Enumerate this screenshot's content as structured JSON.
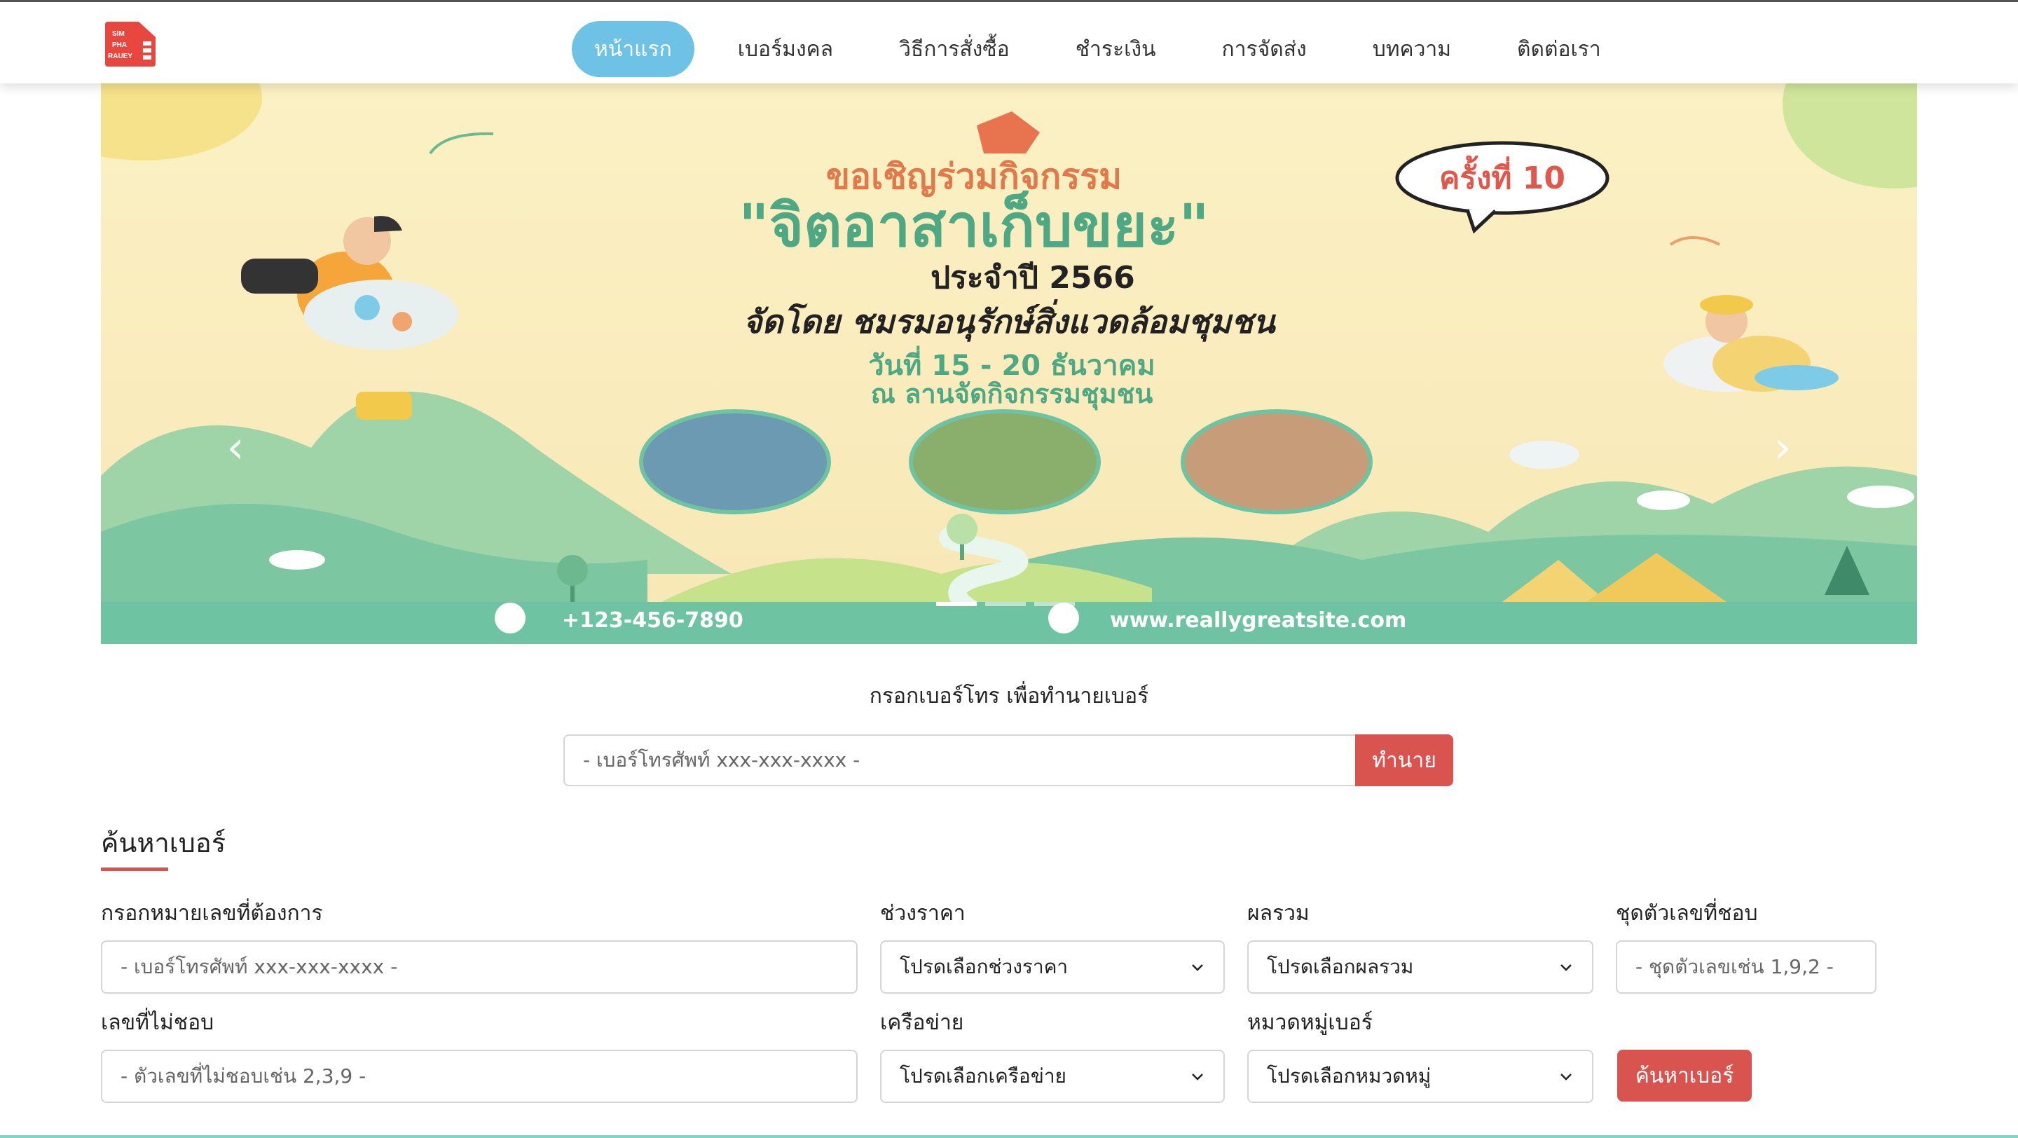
{
  "logo": {
    "lines": [
      "SIM",
      "PHA",
      "RAUEY"
    ],
    "color": "#e8473f"
  },
  "nav": {
    "items": [
      {
        "label": "หน้าแรก",
        "active": true
      },
      {
        "label": "เบอร์มงคล"
      },
      {
        "label": "วิธีการสั่งซื้อ"
      },
      {
        "label": "ชำระเงิน"
      },
      {
        "label": "การจัดส่ง"
      },
      {
        "label": "บทความ"
      },
      {
        "label": "ติดต่อเรา"
      }
    ],
    "active_color": "#6ec2e6"
  },
  "banner": {
    "heading": "ขอเชิญร่วมกิจกรรม",
    "title": "\"จิตอาสาเก็บขยะ\"",
    "edition": "ครั้งที่ 10",
    "year": "ประจำปี 2566",
    "organizer": "จัดโดย ชมรมอนุรักษ์สิ่งแวดล้อมชุมชน",
    "date": "วันที่ 15 - 20 ธันวาคม",
    "venue": "ณ ลานจัดกิจกรรมชุมชน",
    "phone": "+123-456-7890",
    "website": "www.reallygreatsite.com",
    "prev_icon": "‹",
    "next_icon": "›",
    "slides": 3,
    "active_slide": 1
  },
  "predict": {
    "label": "กรอกเบอร์โทร เพื่อทำนายเบอร์",
    "placeholder": "- เบอร์โทรศัพท์ xxx-xxx-xxxx -",
    "button": "ทำนาย"
  },
  "search": {
    "title": "ค้นหาเบอร์",
    "number_label": "กรอกหมายเลขที่ต้องการ",
    "number_placeholder": "- เบอร์โทรศัพท์ xxx-xxx-xxxx -",
    "price_label": "ช่วงราคา",
    "price_value": "โปรดเลือกช่วงราคา",
    "sum_label": "ผลรวม",
    "sum_value": "โปรดเลือกผลรวม",
    "fav_label": "ชุดตัวเลขที่ชอบ",
    "fav_placeholder": "- ชุดตัวเลขเช่น 1,9,2 -",
    "dislike_label": "เลขที่ไม่ชอบ",
    "dislike_placeholder": "- ตัวเลขที่ไม่ชอบเช่น 2,3,9 -",
    "network_label": "เครือข่าย",
    "network_value": "โปรดเลือกเครือข่าย",
    "category_label": "หมวดหมู่เบอร์",
    "category_value": "โปรดเลือกหมวดหมู่",
    "button": "ค้นหาเบอร์",
    "accent": "#d9534f"
  }
}
